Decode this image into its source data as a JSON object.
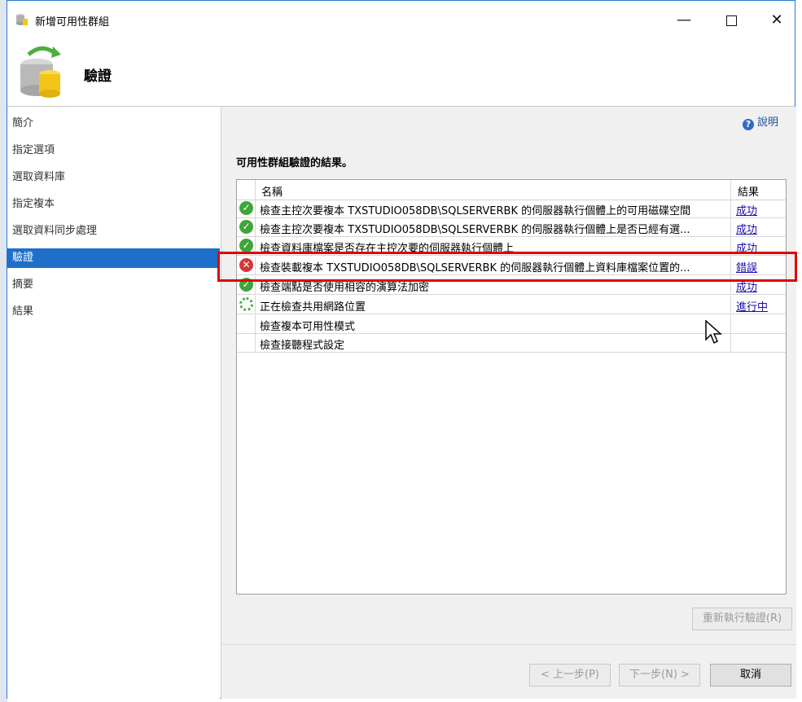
{
  "window": {
    "title": "新增可用性群組",
    "minimize": "—",
    "close": "✕"
  },
  "header": {
    "title": "驗證"
  },
  "nav": {
    "items": [
      {
        "label": "簡介"
      },
      {
        "label": "指定選項"
      },
      {
        "label": "選取資料庫"
      },
      {
        "label": "指定複本"
      },
      {
        "label": "選取資料同步處理"
      },
      {
        "label": "驗證",
        "active": true
      },
      {
        "label": "摘要"
      },
      {
        "label": "結果"
      }
    ]
  },
  "content": {
    "help_label": "說明",
    "section_title": "可用性群組驗證的結果。",
    "columns": {
      "name": "名稱",
      "result": "結果"
    },
    "rows": [
      {
        "status": "success",
        "name": "檢查主控次要複本 TXSTUDIO058DB\\SQLSERVERBK 的伺服器執行個體上的可用磁碟空間",
        "result": "成功"
      },
      {
        "status": "success",
        "name": "檢查主控次要複本 TXSTUDIO058DB\\SQLSERVERBK 的伺服器執行個體上是否已經有選...",
        "result": "成功"
      },
      {
        "status": "success",
        "name": "檢查資料庫檔案是否存在主控次要的伺服器執行個體上",
        "result": "成功"
      },
      {
        "status": "error",
        "name": "檢查裝載複本 TXSTUDIO058DB\\SQLSERVERBK 的伺服器執行個體上資料庫檔案位置的...",
        "result": "錯誤"
      },
      {
        "status": "success",
        "name": "檢查端點是否使用相容的演算法加密",
        "result": "成功"
      },
      {
        "status": "in-progress",
        "name": "正在檢查共用網路位置",
        "result": "進行中"
      },
      {
        "status": "pending",
        "name": "檢查複本可用性模式",
        "result": ""
      },
      {
        "status": "pending",
        "name": "檢查接聽程式設定",
        "result": ""
      }
    ]
  },
  "buttons": {
    "rerun": "重新執行驗證(R)",
    "prev": "< 上一步(P)",
    "next": "下一步(N) >",
    "cancel": "取消"
  },
  "colors": {
    "accent": "#1e6fc9",
    "success": "#3ea63a",
    "error": "#d53838",
    "highlight": "#e00000"
  }
}
